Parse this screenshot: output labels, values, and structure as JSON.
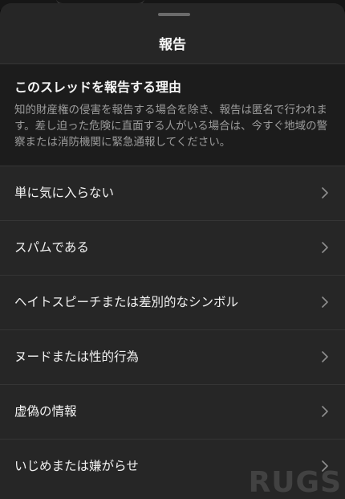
{
  "sheet": {
    "title": "報告"
  },
  "intro": {
    "heading": "このスレッドを報告する理由",
    "body": "知的財産権の侵害を報告する場合を除き、報告は匿名で行われます。差し迫った危険に直面する人がいる場合は、今すぐ地域の警察または消防機関に緊急通報してください。"
  },
  "reasons": [
    {
      "label": "単に気に入らない",
      "icon": "chevron-right-icon"
    },
    {
      "label": "スパムである",
      "icon": "chevron-right-icon"
    },
    {
      "label": "ヘイトスピーチまたは差別的なシンボル",
      "icon": "chevron-right-icon"
    },
    {
      "label": "ヌードまたは性的行為",
      "icon": "chevron-right-icon"
    },
    {
      "label": "虚偽の情報",
      "icon": "chevron-right-icon"
    },
    {
      "label": "いじめまたは嫌がらせ",
      "icon": "chevron-right-icon"
    }
  ],
  "watermark": "RUGS",
  "colors": {
    "sheet_background": "#262626",
    "intro_background": "#1c1c1c",
    "text_primary": "#f2f2f2",
    "text_secondary": "#9c9c9c",
    "divider": "#353535"
  }
}
